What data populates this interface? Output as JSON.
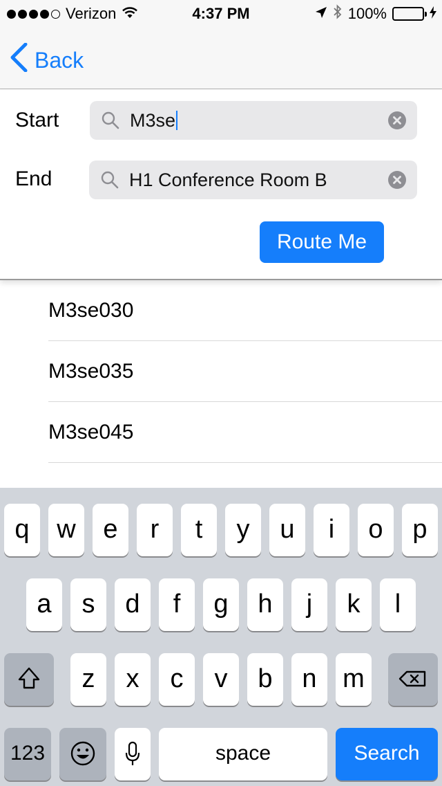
{
  "status_bar": {
    "carrier": "Verizon",
    "time": "4:37 PM",
    "battery": "100%",
    "signal_icon": "signal-dots-icon",
    "wifi_icon": "wifi-icon",
    "location_icon": "location-arrow-icon",
    "bluetooth_icon": "bluetooth-icon",
    "battery_level": 1.0,
    "battery_color": "#4cd964"
  },
  "nav": {
    "back_label": "Back",
    "back_icon": "chevron-left-icon",
    "accent_color": "#157efb"
  },
  "form": {
    "start_label": "Start",
    "start_value": "M3se",
    "end_label": "End",
    "end_value": "H1 Conference Room B",
    "route_button": "Route Me"
  },
  "results": {
    "items": [
      "M3se030",
      "M3se035",
      "M3se045"
    ]
  },
  "keyboard": {
    "row1": [
      "q",
      "w",
      "e",
      "r",
      "t",
      "y",
      "u",
      "i",
      "o",
      "p"
    ],
    "row2": [
      "a",
      "s",
      "d",
      "f",
      "g",
      "h",
      "j",
      "k",
      "l"
    ],
    "row3": [
      "z",
      "x",
      "c",
      "v",
      "b",
      "n",
      "m"
    ],
    "numbers_key": "123",
    "space_key": "space",
    "search_key": "Search",
    "shift_icon": "shift-icon",
    "delete_icon": "backspace-icon",
    "emoji_icon": "emoji-icon",
    "mic_icon": "microphone-icon"
  }
}
